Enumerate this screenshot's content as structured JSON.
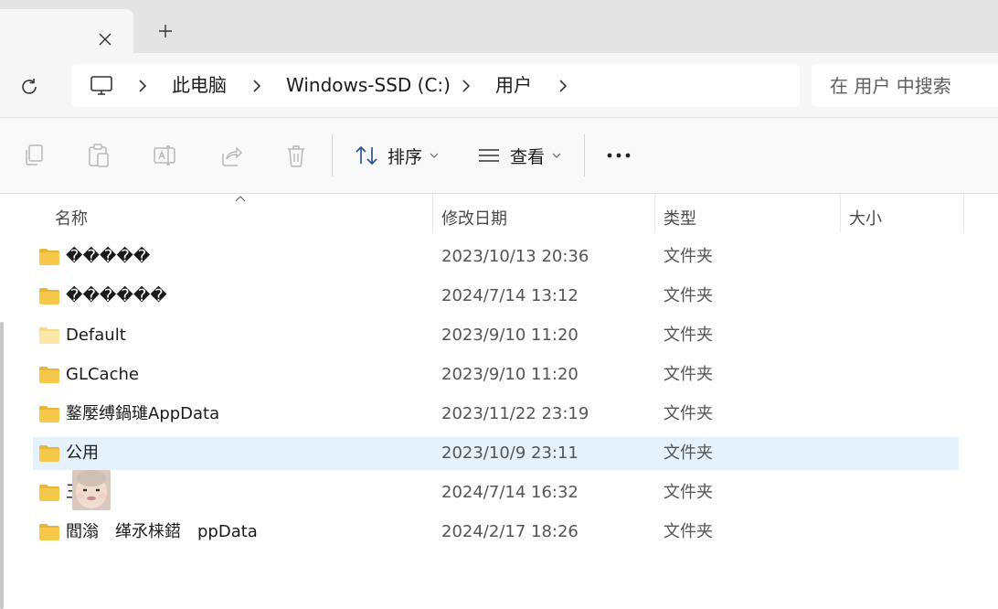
{
  "breadcrumbs": [
    "此电脑",
    "Windows-SSD (C:)",
    "用户"
  ],
  "search": {
    "placeholder": "在 用户 中搜索"
  },
  "toolbar": {
    "sort_label": "排序",
    "view_label": "查看"
  },
  "columns": [
    "名称",
    "修改日期",
    "类型",
    "大小"
  ],
  "files": [
    {
      "name": "�����",
      "date": "2023/10/13 20:36",
      "type": "文件夹",
      "icon": "folder-icon"
    },
    {
      "name": "������",
      "date": "2024/7/14 13:12",
      "type": "文件夹",
      "icon": "folder-icon"
    },
    {
      "name": "Default",
      "date": "2023/9/10 11:20",
      "type": "文件夹",
      "icon": "folder-light-icon"
    },
    {
      "name": "GLCache",
      "date": "2023/9/10 11:20",
      "type": "文件夹",
      "icon": "folder-icon"
    },
    {
      "name": "鐜嬮缚鍋璡AppData",
      "date": "2023/11/22 23:19",
      "type": "文件夹",
      "icon": "folder-icon"
    },
    {
      "name": "公用",
      "date": "2023/10/9 23:11",
      "type": "文件夹",
      "icon": "folder-icon",
      "selected": true
    },
    {
      "name": "王鸿",
      "date": "2024/7/14 16:32",
      "type": "文件夹",
      "icon": "folder-icon"
    },
    {
      "name": "閻滃　缂氶梾鍣　ppData",
      "date": "2024/2/17 18:26",
      "type": "文件夹",
      "icon": "folder-icon"
    }
  ],
  "colors": {
    "selected_row": "#e5f1fb",
    "folder": "#f7c94a"
  }
}
